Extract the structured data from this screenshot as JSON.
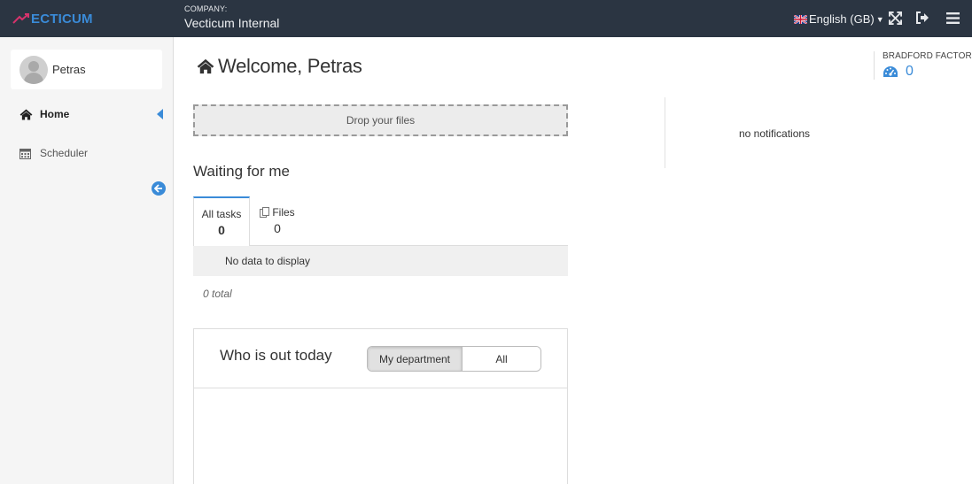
{
  "topbar": {
    "logo_text": "ECTICUM",
    "company_label": "COMPANY:",
    "company_name": "Vecticum Internal",
    "language": "English (GB)"
  },
  "sidebar": {
    "user_name": "Petras",
    "items": [
      {
        "label": "Home",
        "icon": "home-icon",
        "active": true
      },
      {
        "label": "Scheduler",
        "icon": "calendar-icon",
        "active": false
      }
    ]
  },
  "main": {
    "title": "Welcome, Petras",
    "dropzone_text": "Drop your files",
    "waiting_title": "Waiting for me",
    "tabs": [
      {
        "label": "All tasks",
        "count": "0",
        "active": true
      },
      {
        "label": "Files",
        "count": "0",
        "active": false
      }
    ],
    "no_data": "No data to display",
    "total": "0 total",
    "out_today": {
      "title": "Who is out today",
      "options": [
        "My department",
        "All"
      ],
      "selected": "My department"
    }
  },
  "bradford": {
    "label": "BRADFORD FACTOR",
    "value": "0"
  },
  "notifications": {
    "empty_text": "no notifications"
  },
  "colors": {
    "topbar": "#2b3542",
    "accent": "#3a8bd8",
    "logo_mark": "#d6336c"
  }
}
